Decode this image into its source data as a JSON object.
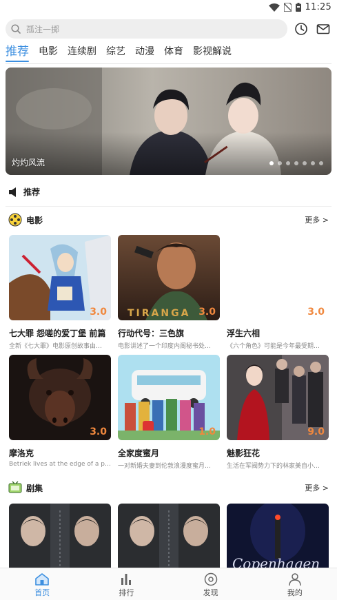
{
  "status_bar": {
    "time": "11:25"
  },
  "search": {
    "placeholder": "孤注一掷"
  },
  "tabs": [
    "推荐",
    "电影",
    "连续剧",
    "综艺",
    "动漫",
    "体育",
    "影视解说"
  ],
  "banner": {
    "caption": "灼灼风流",
    "dot_count": 7,
    "active_dot": 0
  },
  "notice": {
    "label": "推荐"
  },
  "sections": {
    "movies": {
      "title": "电影",
      "more": "更多 >"
    },
    "series": {
      "title": "剧集",
      "more": "更多 >"
    }
  },
  "movies": [
    {
      "title": "七大罪 怨嗟的爱丁堡 前篇",
      "desc": "全新《七大罪》电影原创故事由…",
      "score": "3.0"
    },
    {
      "title": "行动代号：三色旗",
      "desc": "电影讲述了一个印度内阁秘书处…",
      "score": "3.0"
    },
    {
      "title": "浮生六相",
      "desc": "《六个角色》可能是今年最受期…",
      "score": "3.0"
    },
    {
      "title": "摩洛克",
      "desc": "Betriek lives at the edge of a peat…",
      "score": "3.0"
    },
    {
      "title": "全家度蜜月",
      "desc": "一对新婚夫妻到伦敦浪漫度蜜月…",
      "score": "1.0"
    },
    {
      "title": "魅影狂花",
      "desc": "生活在军阀势力下的林家美自小…",
      "score": "9.0"
    }
  ],
  "series_posters": [
    "series-poster-1",
    "series-poster-2",
    "series-poster-3"
  ],
  "bottom_nav": [
    {
      "label": "首页",
      "icon": "home-icon",
      "active": true
    },
    {
      "label": "排行",
      "icon": "ranking-icon",
      "active": false
    },
    {
      "label": "发现",
      "icon": "discover-icon",
      "active": false
    },
    {
      "label": "我的",
      "icon": "profile-icon",
      "active": false
    }
  ],
  "colors": {
    "accent": "#3d8fe0",
    "score": "#f0883e"
  }
}
